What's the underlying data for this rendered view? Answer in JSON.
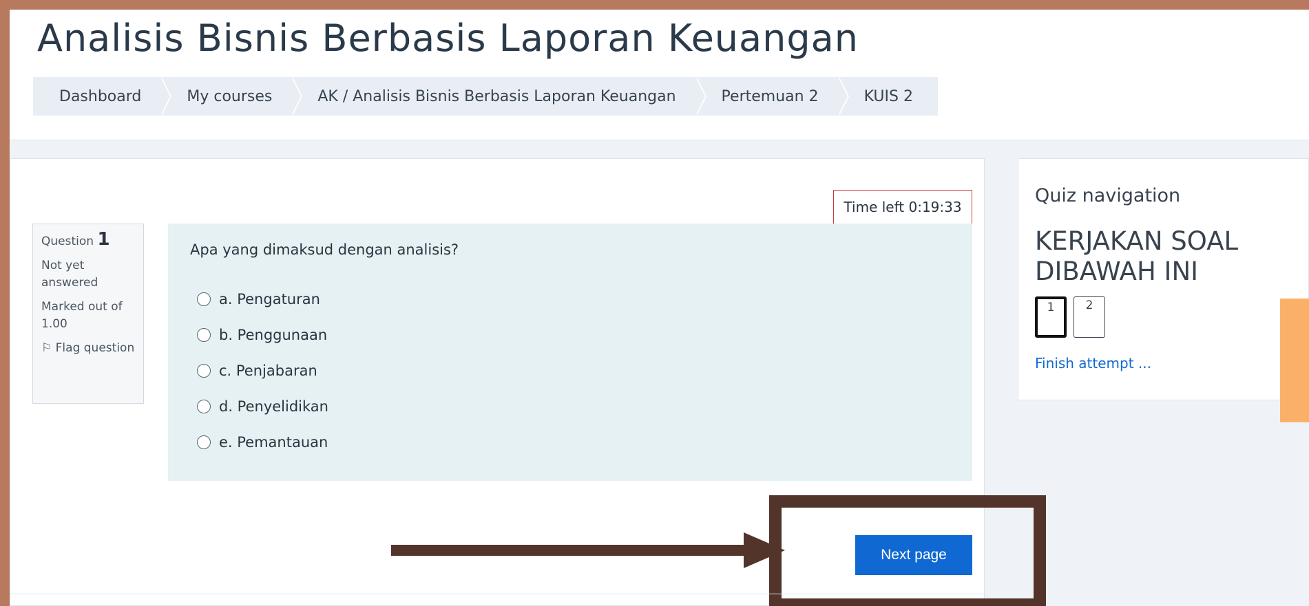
{
  "page": {
    "title": "Analisis Bisnis Berbasis Laporan Keuangan"
  },
  "breadcrumb": [
    {
      "label": "Dashboard"
    },
    {
      "label": "My courses"
    },
    {
      "label": "AK / Analisis Bisnis Berbasis Laporan Keuangan"
    },
    {
      "label": "Pertemuan 2"
    },
    {
      "label": "KUIS 2"
    }
  ],
  "timer": {
    "label": "Time left 0:19:33"
  },
  "question": {
    "prefix": "Question",
    "number": "1",
    "status": "Not yet answered",
    "marked": "Marked out of 1.00",
    "flag_label": "Flag question",
    "text": "Apa yang dimaksud dengan analisis?",
    "options": [
      {
        "label": "a. Pengaturan"
      },
      {
        "label": "b. Penggunaan"
      },
      {
        "label": "c. Penjabaran"
      },
      {
        "label": "d. Penyelidikan"
      },
      {
        "label": "e. Pemantauan"
      }
    ]
  },
  "next_button": {
    "label": "Next page"
  },
  "quiz_nav": {
    "title": "Quiz navigation",
    "heading": "KERJAKAN SOAL DIBAWAH INI",
    "buttons": [
      "1",
      "2"
    ],
    "finish_label": "Finish attempt ..."
  },
  "colors": {
    "outer_border": "#b87a5f",
    "accent_blue": "#1069d2",
    "annotation_brown": "#53342a",
    "timer_border": "#c9383a",
    "question_bg": "#e5f1f3",
    "orange_tab": "#fbb06a"
  }
}
